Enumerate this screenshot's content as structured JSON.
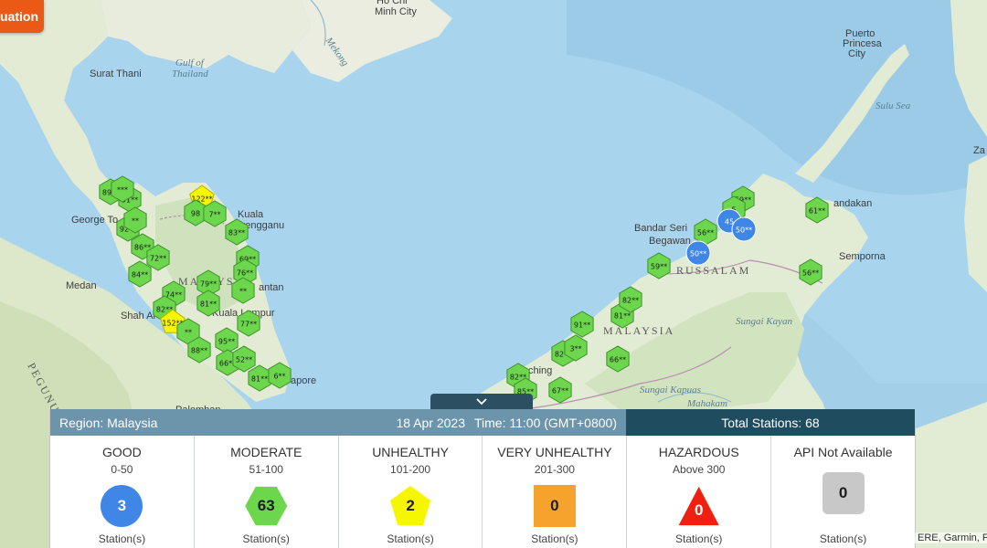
{
  "situation_button": {
    "label": "uation"
  },
  "map": {
    "places": [
      {
        "name": "Surat Thani",
        "kind": "city"
      },
      {
        "name": "Gulf of",
        "kind": "water"
      },
      {
        "name": "Thailand",
        "kind": "water"
      },
      {
        "name": "Ho Chi",
        "kind": "city"
      },
      {
        "name": "Minh City",
        "kind": "city"
      },
      {
        "name": "Mekong",
        "kind": "water"
      },
      {
        "name": "Puerto",
        "kind": "city"
      },
      {
        "name": "Princesa",
        "kind": "city"
      },
      {
        "name": "City",
        "kind": "city"
      },
      {
        "name": "Sulu Sea",
        "kind": "water"
      },
      {
        "name": "George To",
        "kind": "city"
      },
      {
        "name": "Kuala",
        "kind": "city"
      },
      {
        "name": "Terengganu",
        "kind": "city"
      },
      {
        "name": "Medan",
        "kind": "city"
      },
      {
        "name": "MALAYS",
        "kind": "country"
      },
      {
        "name": "Shah Al",
        "kind": "city"
      },
      {
        "name": "Kuala Lumpur",
        "kind": "city"
      },
      {
        "name": "antan",
        "kind": "city"
      },
      {
        "name": "apore",
        "kind": "city"
      },
      {
        "name": "PEGUNUN",
        "kind": "country"
      },
      {
        "name": "Bandar Seri",
        "kind": "city"
      },
      {
        "name": "Begawan",
        "kind": "city"
      },
      {
        "name": "RUSSALAM",
        "kind": "country"
      },
      {
        "name": "MALAYSIA",
        "kind": "country"
      },
      {
        "name": "ching",
        "kind": "city"
      },
      {
        "name": "andakan",
        "kind": "city"
      },
      {
        "name": "Semporna",
        "kind": "city"
      },
      {
        "name": "Sungai Kapuas",
        "kind": "water"
      },
      {
        "name": "Mahakam",
        "kind": "water"
      },
      {
        "name": "Sungai Kayan",
        "kind": "water"
      },
      {
        "name": "Palemban",
        "kind": "city"
      },
      {
        "name": "Za",
        "kind": "city"
      }
    ],
    "markers": [
      {
        "label": "89**",
        "level": "moderate"
      },
      {
        "label": "91**",
        "level": "moderate"
      },
      {
        "label": "***",
        "level": "moderate"
      },
      {
        "label": "92**",
        "level": "moderate"
      },
      {
        "label": "**",
        "level": "moderate"
      },
      {
        "label": "86**",
        "level": "moderate"
      },
      {
        "label": "72**",
        "level": "moderate"
      },
      {
        "label": "84**",
        "level": "moderate"
      },
      {
        "label": "122**",
        "level": "unhealthy"
      },
      {
        "label": "98",
        "level": "moderate"
      },
      {
        "label": "7**",
        "level": "moderate"
      },
      {
        "label": "83**",
        "level": "moderate"
      },
      {
        "label": "69**",
        "level": "moderate"
      },
      {
        "label": "76**",
        "level": "moderate"
      },
      {
        "label": "**",
        "level": "moderate"
      },
      {
        "label": "79**",
        "level": "moderate"
      },
      {
        "label": "74**",
        "level": "moderate"
      },
      {
        "label": "81**",
        "level": "moderate"
      },
      {
        "label": "82**",
        "level": "moderate"
      },
      {
        "label": "152**",
        "level": "unhealthy"
      },
      {
        "label": "77**",
        "level": "moderate"
      },
      {
        "label": "**",
        "level": "moderate"
      },
      {
        "label": "95**",
        "level": "moderate"
      },
      {
        "label": "88**",
        "level": "moderate"
      },
      {
        "label": "66**",
        "level": "moderate"
      },
      {
        "label": "52**",
        "level": "moderate"
      },
      {
        "label": "81**",
        "level": "moderate"
      },
      {
        "label": "6**",
        "level": "moderate"
      },
      {
        "label": "82**",
        "level": "moderate"
      },
      {
        "label": "85**",
        "level": "moderate"
      },
      {
        "label": "67**",
        "level": "moderate"
      },
      {
        "label": "82**",
        "level": "moderate"
      },
      {
        "label": "3**",
        "level": "moderate"
      },
      {
        "label": "91**",
        "level": "moderate"
      },
      {
        "label": "81**",
        "level": "moderate"
      },
      {
        "label": "82**",
        "level": "moderate"
      },
      {
        "label": "66**",
        "level": "moderate"
      },
      {
        "label": "59**",
        "level": "moderate"
      },
      {
        "label": "56**",
        "level": "moderate"
      },
      {
        "label": "59**",
        "level": "moderate"
      },
      {
        "label": "5",
        "level": "moderate"
      },
      {
        "label": "45",
        "level": "good"
      },
      {
        "label": "50**",
        "level": "good"
      },
      {
        "label": "50**",
        "level": "good"
      },
      {
        "label": "61**",
        "level": "moderate"
      },
      {
        "label": "56**",
        "level": "moderate"
      }
    ],
    "colors": {
      "good": "#3f86e6",
      "moderate": "#6cd64c",
      "unhealthy": "#f6f600",
      "very_unhealthy": "#f6a32d",
      "hazardous": "#f11f10",
      "na": "#c8c8c8"
    }
  },
  "panel": {
    "collapse_icon": "chevron-down-icon",
    "region": "Region: Malaysia",
    "date": "18 Apr 2023",
    "time": "Time: 11:00 (GMT+0800)",
    "total": "Total Stations: 68",
    "categories": [
      {
        "name": "GOOD",
        "range": "0-50",
        "count": "3",
        "unit": "Station(s)",
        "shape": "circle"
      },
      {
        "name": "MODERATE",
        "range": "51-100",
        "count": "63",
        "unit": "Station(s)",
        "shape": "hexagon"
      },
      {
        "name": "UNHEALTHY",
        "range": "101-200",
        "count": "2",
        "unit": "Station(s)",
        "shape": "pentagon"
      },
      {
        "name": "VERY UNHEALTHY",
        "range": "201-300",
        "count": "0",
        "unit": "Station(s)",
        "shape": "square"
      },
      {
        "name": "HAZARDOUS",
        "range": "Above 300",
        "count": "0",
        "unit": "Station(s)",
        "shape": "triangle"
      },
      {
        "name": "API Not Available",
        "range": "",
        "count": "0",
        "unit": "Station(s)",
        "shape": "rounded-square"
      }
    ]
  },
  "attribution": "ERE, Garmin, FA"
}
